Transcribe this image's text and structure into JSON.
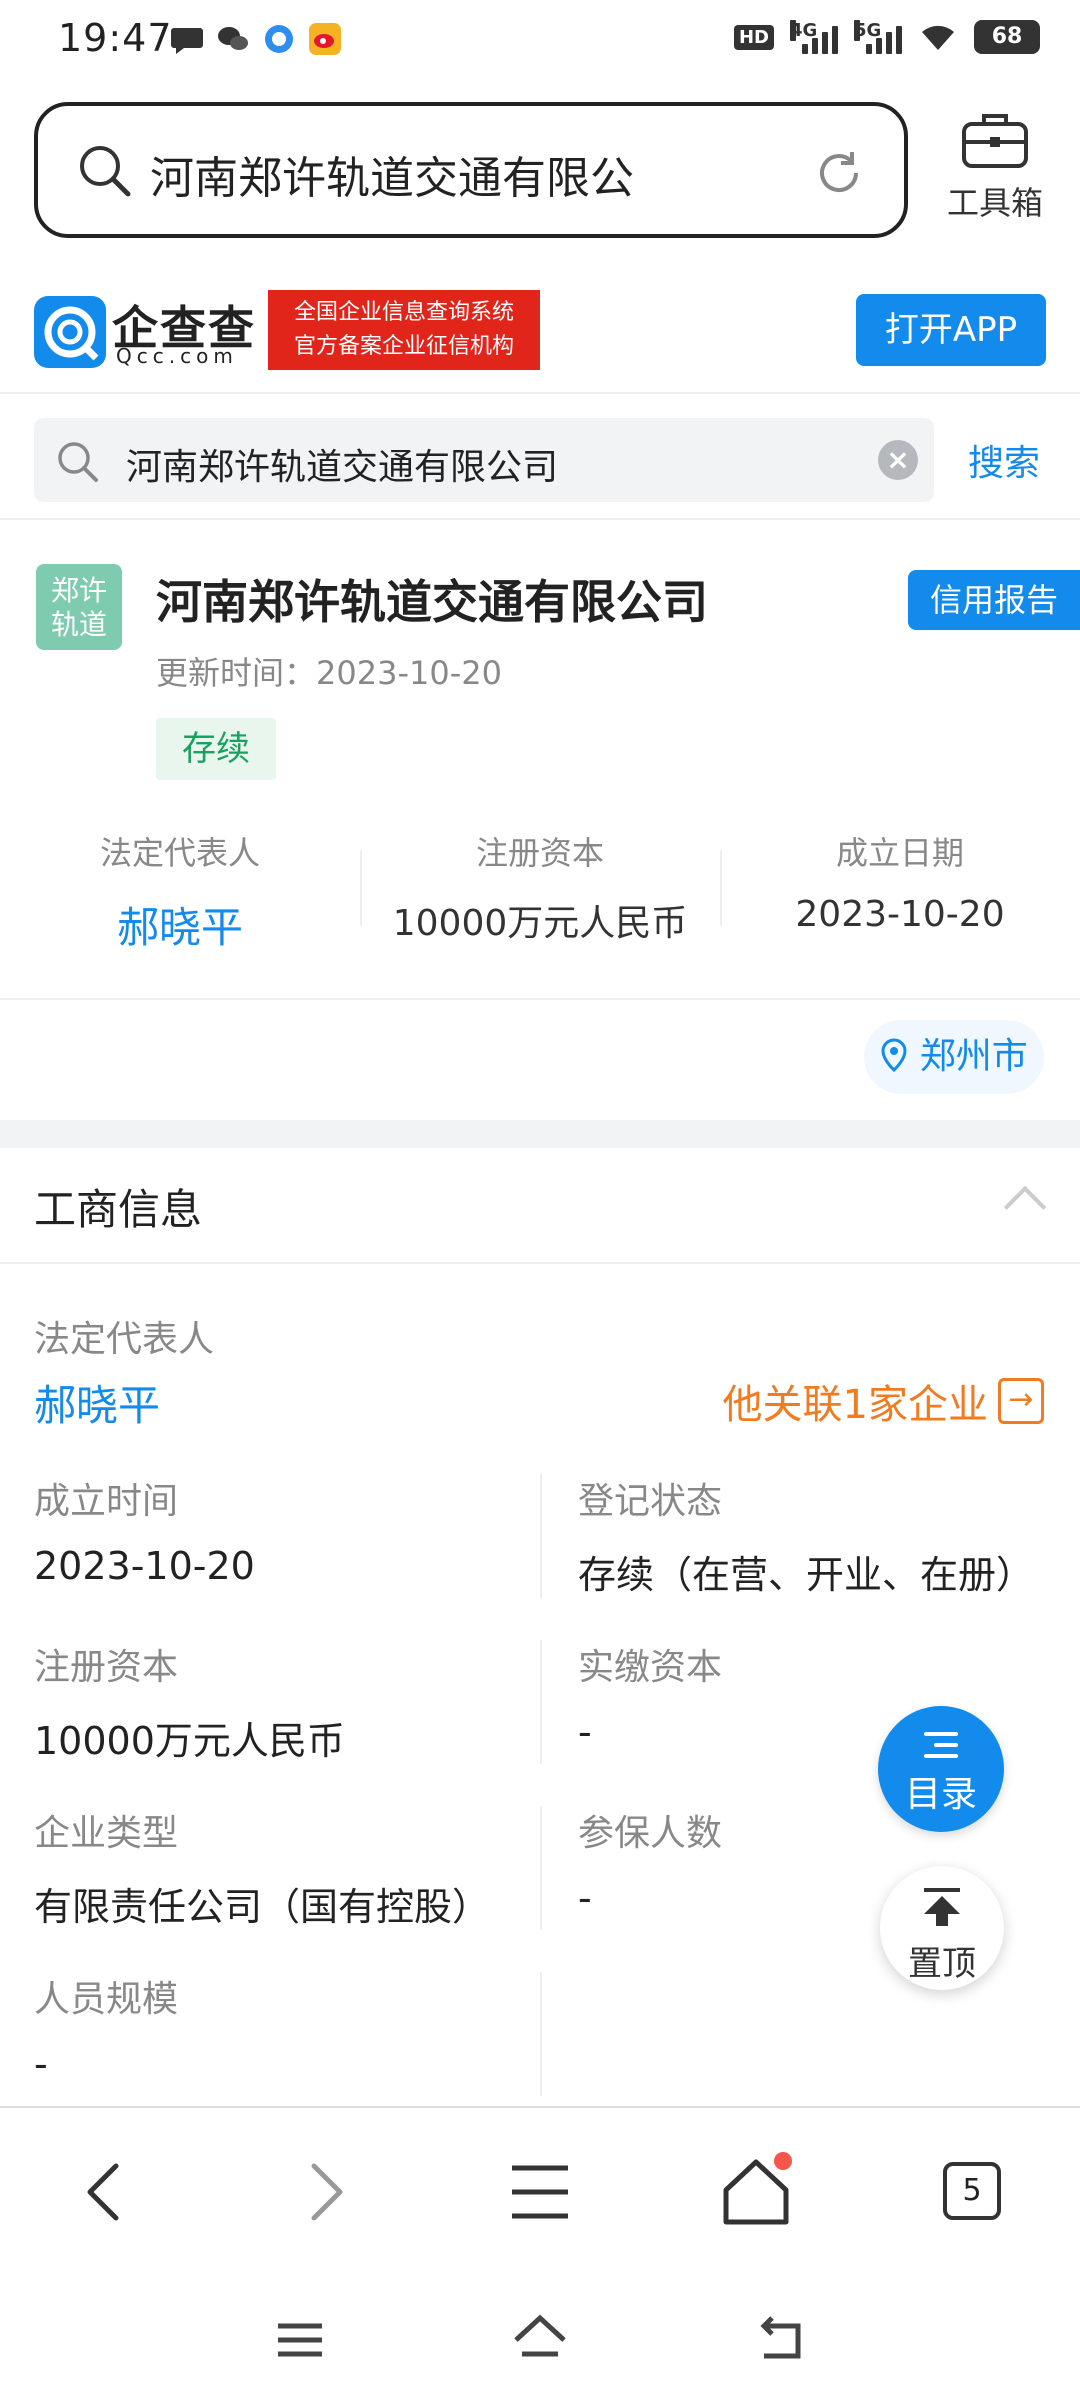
{
  "status_bar": {
    "time": "19:47",
    "signal_1": "4G",
    "signal_2": "5G",
    "hd": "HD",
    "battery": "68",
    "app_icons": [
      "message-icon",
      "wechat-icon",
      "qq-browser-icon",
      "weibo-icon"
    ]
  },
  "browser": {
    "address_text": "河南郑许轨道交通有限公",
    "toolbox_label": "工具箱"
  },
  "qcc": {
    "brand": "企查查",
    "domain": "Qcc.com",
    "slogan_line1": "全国企业信息查询系统",
    "slogan_line2": "官方备案企业征信机构",
    "open_app": "打开APP"
  },
  "search": {
    "value": "河南郑许轨道交通有限公司",
    "button": "搜索"
  },
  "company": {
    "logo_line1": "郑许",
    "logo_line2": "轨道",
    "name": "河南郑许轨道交通有限公司",
    "credit_report": "信用报告",
    "update_time": "更新时间：2023-10-20",
    "status": "存续",
    "legal_rep_label": "法定代表人",
    "legal_rep": "郝晓平",
    "capital_label": "注册资本",
    "capital": "10000万元人民币",
    "founded_label": "成立日期",
    "founded": "2023-10-20",
    "city": "郑州市"
  },
  "business_info": {
    "title": "工商信息",
    "legal_rep_label": "法定代表人",
    "legal_rep": "郝晓平",
    "related": "他关联1家企业",
    "rows": [
      [
        {
          "k": "成立时间",
          "v": "2023-10-20"
        },
        {
          "k": "登记状态",
          "v": "存续（在营、开业、在册）"
        }
      ],
      [
        {
          "k": "注册资本",
          "v": "10000万元人民币"
        },
        {
          "k": "实缴资本",
          "v": "-"
        }
      ],
      [
        {
          "k": "企业类型",
          "v": "有限责任公司（国有控股）"
        },
        {
          "k": "参保人数",
          "v": "-"
        }
      ],
      [
        {
          "k": "人员规模",
          "v": "-"
        },
        {
          "k": "",
          "v": ""
        }
      ]
    ]
  },
  "fab": {
    "menu": "目录",
    "top": "置顶"
  },
  "bottom_nav": {
    "tabs_count": "5"
  },
  "colors": {
    "accent": "#128bed",
    "status_green": "#19a15f",
    "orange": "#f27b1f",
    "red": "#e1251b"
  }
}
